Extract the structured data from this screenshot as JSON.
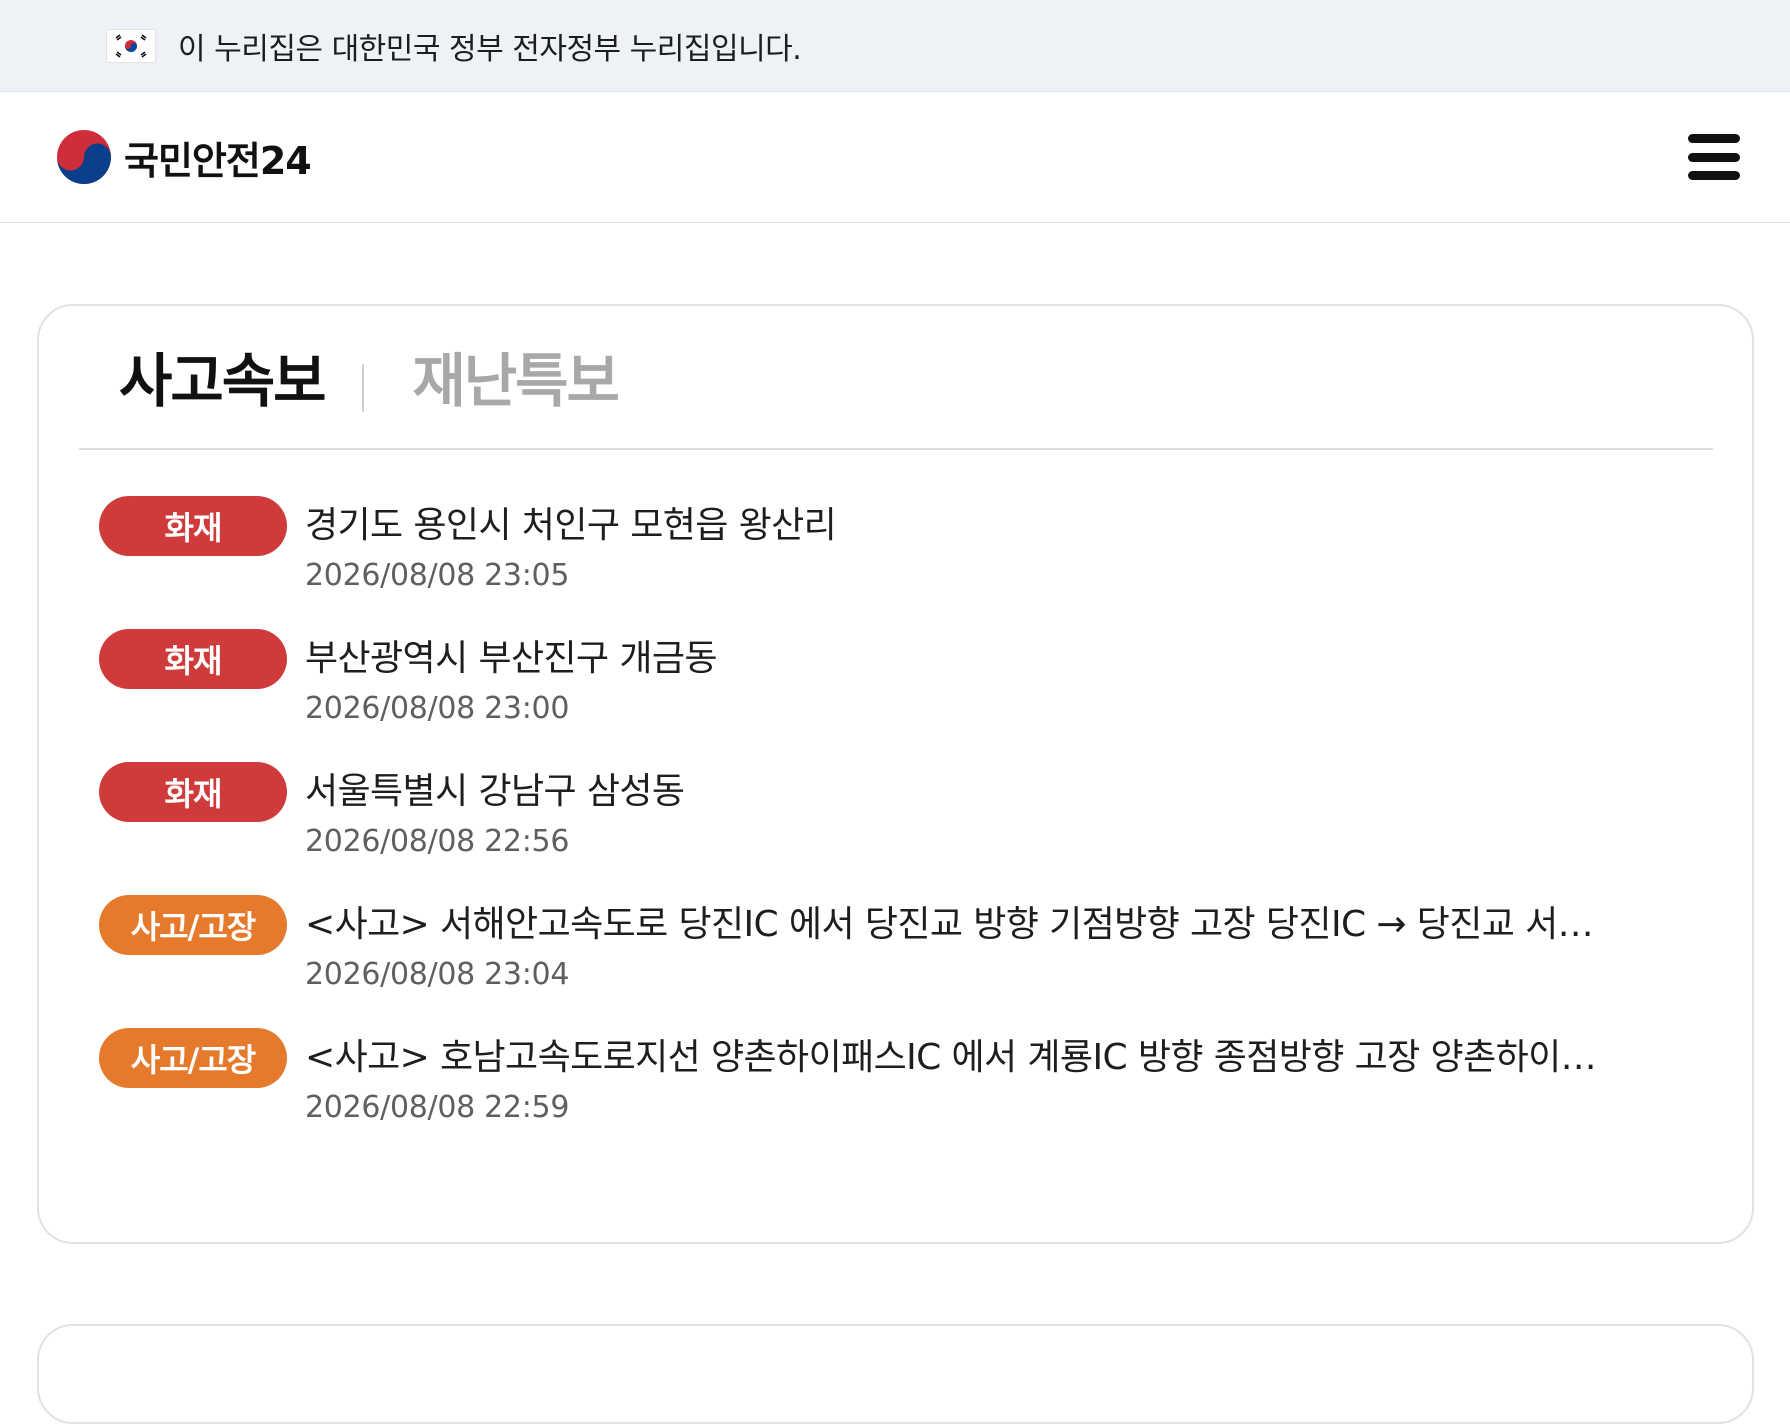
{
  "gov_banner": {
    "flag_icon": "korea-flag-icon",
    "text": "이 누리집은 대한민국 정부 전자정부 누리집입니다."
  },
  "header": {
    "logo_icon": "taegeuk-logo-icon",
    "logo_text": "국민안전24",
    "menu_icon": "hamburger-menu-icon"
  },
  "tabs": [
    {
      "label": "사고속보",
      "active": true
    },
    {
      "label": "재난특보",
      "active": false
    }
  ],
  "colors": {
    "fire_badge": "#cf3b3b",
    "accident_badge": "#e57a2c"
  },
  "items": [
    {
      "badge": "화재",
      "title": "경기도 용인시 처인구 모현읍 왕산리",
      "date": "2026/08/08 23:05"
    },
    {
      "badge": "화재",
      "title": "부산광역시 부산진구 개금동",
      "date": "2026/08/08 23:00"
    },
    {
      "badge": "화재",
      "title": "서울특별시 강남구 삼성동",
      "date": "2026/08/08 22:56"
    },
    {
      "badge": "사고/고장",
      "title": "<사고> 서해안고속도로 당진IC 에서 당진교 방향 기점방향 고장 당진IC → 당진교 서…",
      "date": "2026/08/08 23:04"
    },
    {
      "badge": "사고/고장",
      "title": "<사고> 호남고속도로지선 양촌하이패스IC 에서 계룡IC 방향 종점방향 고장 양촌하이…",
      "date": "2026/08/08 22:59"
    }
  ]
}
